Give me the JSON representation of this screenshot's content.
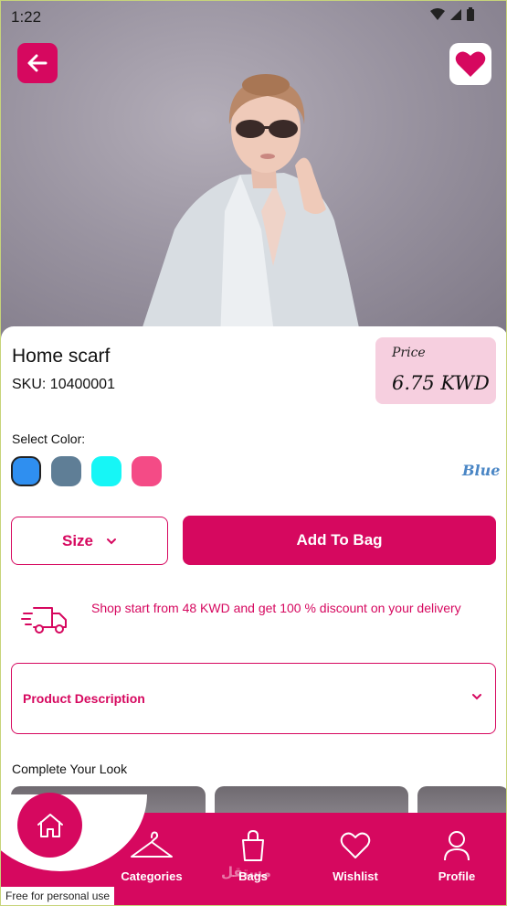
{
  "status_bar": {
    "time": "1:22"
  },
  "product": {
    "title": "Home scarf",
    "sku": "SKU: 10400001",
    "price_label": "Price",
    "price_value": "6.75 KWD"
  },
  "color": {
    "label": "Select Color:",
    "selected": "Blue",
    "swatches": [
      "#2f8ff0",
      "#5f7e96",
      "#16f6f6",
      "#f44b86"
    ]
  },
  "actions": {
    "size_label": "Size",
    "add_label": "Add To Bag"
  },
  "promo": {
    "text": "Shop start from 48 KWD and get 100 % discount on your delivery"
  },
  "description": {
    "label": "Product Description"
  },
  "look": {
    "title": "Complete Your Look"
  },
  "nav": {
    "items": [
      {
        "label": "Categories",
        "icon": "hanger-icon"
      },
      {
        "label": "Bags",
        "icon": "bag-icon"
      },
      {
        "label": "Wishlist",
        "icon": "heart-outline-icon"
      },
      {
        "label": "Profile",
        "icon": "person-icon"
      }
    ],
    "active": "home"
  },
  "watermark": "مستقل",
  "footer_note": "Free for personal use",
  "colors": {
    "accent": "#d6085f",
    "price_bg": "#f6cfdf",
    "selected_text": "#4a86c5"
  }
}
